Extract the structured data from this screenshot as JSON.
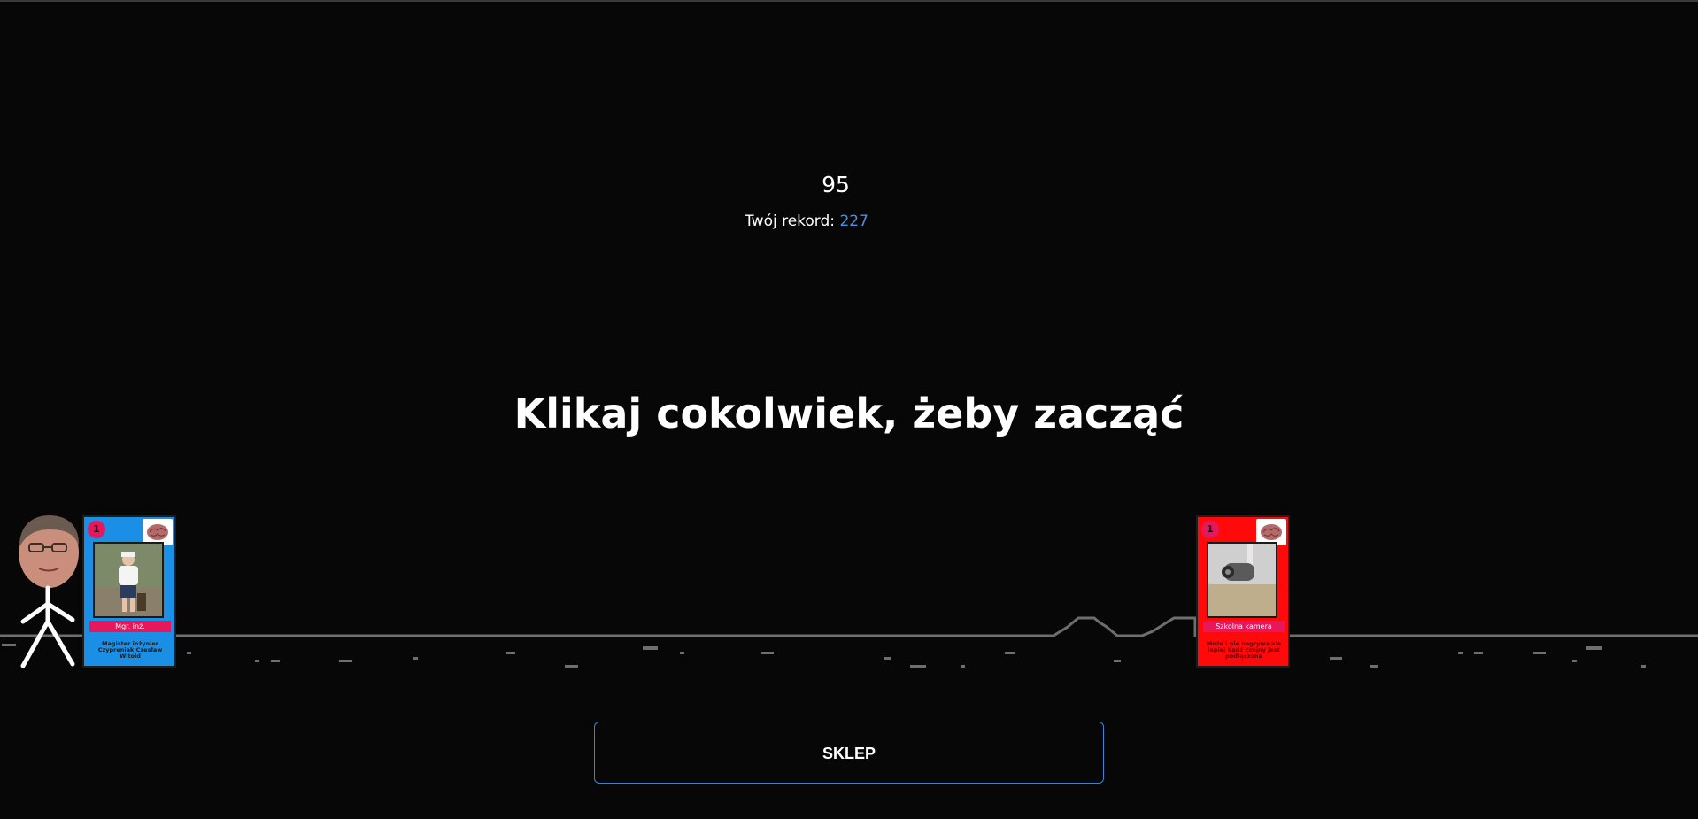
{
  "game": {
    "score": "95",
    "record_label": "Twój rekord:",
    "record_value": "227",
    "start_message": "Klikaj cokolwiek, żeby zacząć"
  },
  "player_card": {
    "level": "1",
    "title": "Mgr. inż.",
    "description": "Magister inżynier Czypreniak Czesław Witold"
  },
  "obstacle_card": {
    "level": "1",
    "title": "Szkolna kamera",
    "description": "Może i nie nagrywa ale lepiej bądź czujny jest podłączona"
  },
  "shop": {
    "label": "SKLEP"
  },
  "colors": {
    "background": "#070707",
    "ground": "#6e6e6e",
    "accent": "#3b82d6",
    "record_value": "#4a90e2",
    "player_card": "#1b8fe6",
    "obstacle_card": "#ff0a0a",
    "card_badge": "#e6175b"
  }
}
